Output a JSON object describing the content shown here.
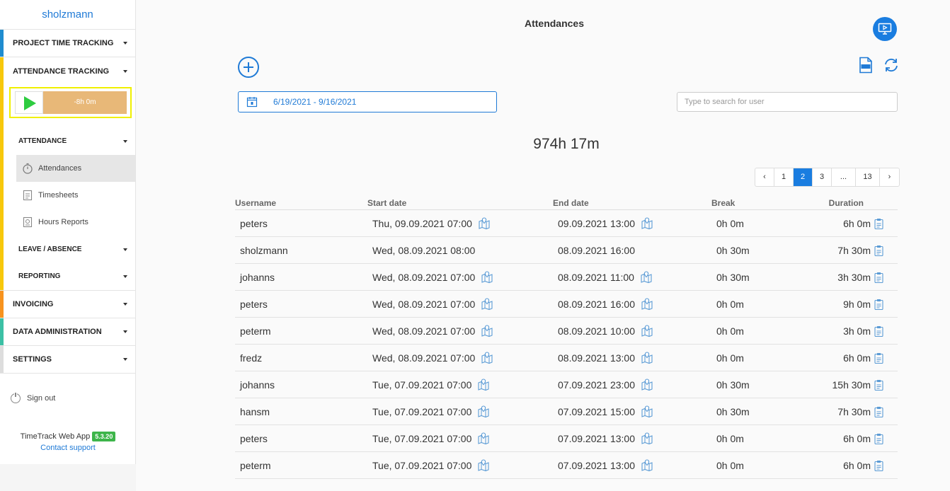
{
  "sidebar": {
    "username": "sholzmann",
    "sections": {
      "project_time_tracking": "PROJECT TIME TRACKING",
      "attendance_tracking": "ATTENDANCE TRACKING",
      "invoicing": "INVOICING",
      "data_administration": "DATA ADMINISTRATION",
      "settings": "SETTINGS"
    },
    "section_colors": {
      "project_time_tracking": "#1f8ccf",
      "attendance_tracking": "#f7c80c",
      "invoicing": "#f7931e",
      "data_administration": "#3cc0a5",
      "settings": "#dddddd"
    },
    "timer": {
      "elapsed": "-8h 0m",
      "accent": "#e8b878",
      "play_color": "#2ecc40"
    },
    "attendance": {
      "label": "ATTENDANCE",
      "items": [
        {
          "label": "Attendances",
          "icon": "stopwatch-icon"
        },
        {
          "label": "Timesheets",
          "icon": "document-icon"
        },
        {
          "label": "Hours Reports",
          "icon": "report-icon"
        }
      ]
    },
    "leave_absence": "LEAVE / ABSENCE",
    "reporting": "REPORTING",
    "sign_out": "Sign out",
    "app_name": "TimeTrack Web App",
    "version": "5.3.20",
    "contact_support": "Contact support"
  },
  "main": {
    "title": "Attendances",
    "date_range": "6/19/2021 - 9/16/2021",
    "search_placeholder": "Type to search for user",
    "total": "974h 17m",
    "accent": "#1a7de0",
    "pagination": [
      "‹",
      "1",
      "2",
      "3",
      "...",
      "13",
      "›"
    ],
    "pagination_active": "2",
    "columns": {
      "username": "Username",
      "start": "Start date",
      "end": "End date",
      "break": "Break",
      "duration": "Duration"
    },
    "rows": [
      {
        "username": "peters",
        "start": "Thu, 09.09.2021 07:00",
        "start_map": true,
        "end": "09.09.2021 13:00",
        "end_map": true,
        "break": "0h 0m",
        "duration": "6h 0m"
      },
      {
        "username": "sholzmann",
        "start": "Wed, 08.09.2021 08:00",
        "start_map": false,
        "end": "08.09.2021 16:00",
        "end_map": false,
        "break": "0h 30m",
        "duration": "7h 30m"
      },
      {
        "username": "johanns",
        "start": "Wed, 08.09.2021 07:00",
        "start_map": true,
        "end": "08.09.2021 11:00",
        "end_map": true,
        "break": "0h 30m",
        "duration": "3h 30m"
      },
      {
        "username": "peters",
        "start": "Wed, 08.09.2021 07:00",
        "start_map": true,
        "end": "08.09.2021 16:00",
        "end_map": true,
        "break": "0h 0m",
        "duration": "9h 0m"
      },
      {
        "username": "peterm",
        "start": "Wed, 08.09.2021 07:00",
        "start_map": true,
        "end": "08.09.2021 10:00",
        "end_map": true,
        "break": "0h 0m",
        "duration": "3h 0m"
      },
      {
        "username": "fredz",
        "start": "Wed, 08.09.2021 07:00",
        "start_map": true,
        "end": "08.09.2021 13:00",
        "end_map": true,
        "break": "0h 0m",
        "duration": "6h 0m"
      },
      {
        "username": "johanns",
        "start": "Tue, 07.09.2021 07:00",
        "start_map": true,
        "end": "07.09.2021 23:00",
        "end_map": true,
        "break": "0h 30m",
        "duration": "15h 30m"
      },
      {
        "username": "hansm",
        "start": "Tue, 07.09.2021 07:00",
        "start_map": true,
        "end": "07.09.2021 15:00",
        "end_map": true,
        "break": "0h 30m",
        "duration": "7h 30m"
      },
      {
        "username": "peters",
        "start": "Tue, 07.09.2021 07:00",
        "start_map": true,
        "end": "07.09.2021 13:00",
        "end_map": true,
        "break": "0h 0m",
        "duration": "6h 0m"
      },
      {
        "username": "peterm",
        "start": "Tue, 07.09.2021 07:00",
        "start_map": true,
        "end": "07.09.2021 13:00",
        "end_map": true,
        "break": "0h 0m",
        "duration": "6h 0m"
      }
    ]
  }
}
